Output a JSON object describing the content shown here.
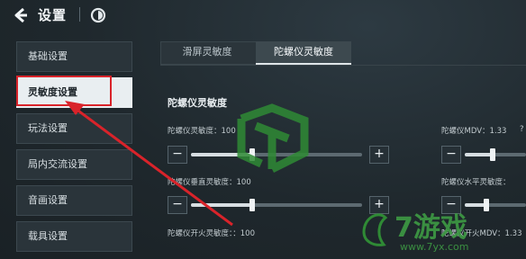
{
  "header": {
    "title": "设置",
    "back_icon": "back-arrow-icon",
    "extra_icon": "settings-badge-icon"
  },
  "sidebar": {
    "items": [
      {
        "label": "基础设置"
      },
      {
        "label": "灵敏度设置"
      },
      {
        "label": "玩法设置"
      },
      {
        "label": "局内交流设置"
      },
      {
        "label": "音画设置"
      },
      {
        "label": "载具设置"
      }
    ],
    "active_index": 1
  },
  "tabs": [
    {
      "label": "滑屏灵敏度"
    },
    {
      "label": "陀螺仪灵敏度"
    }
  ],
  "section": {
    "title": "陀螺仪灵敏度"
  },
  "settings": {
    "gyro_sensitivity": {
      "label": "陀螺仪灵敏度：100",
      "level": 0.36
    },
    "gyro_mdv": {
      "label": "陀螺仪MDV：1.33",
      "help": "?",
      "level": 0.45
    },
    "gyro_vertical": {
      "label": "陀螺仪垂直灵敏度：100",
      "level": 0.36
    },
    "gyro_horizontal": {
      "label": "陀螺仪水平灵敏度：",
      "level": 0.36
    },
    "gyro_fire": {
      "label": "陀螺仪开火灵敏度：：100",
      "level": 0.36
    },
    "gyro_fire_mdv": {
      "label": "陀螺仪开火MDV：1.33"
    }
  },
  "buttons": {
    "minus": "−",
    "plus": "+"
  },
  "watermark": {
    "text": "7游戏",
    "url": "www.7yx.com"
  },
  "colors": {
    "annotation_red": "#d9232a",
    "watermark_green": "#2f8a35"
  }
}
